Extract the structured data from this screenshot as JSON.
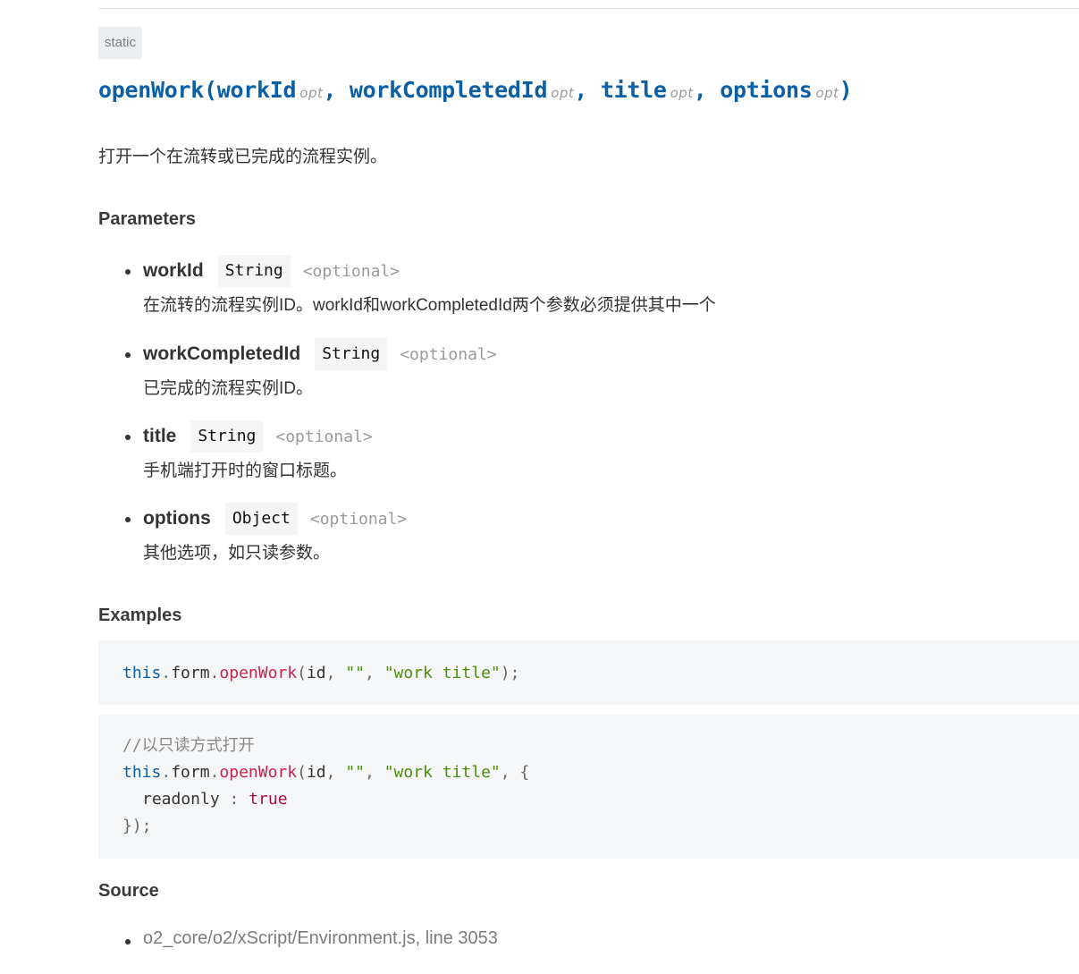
{
  "badge": "static",
  "signature": {
    "name": "openWork",
    "open_paren": "(",
    "close_paren": ")",
    "separator": ",",
    "opt_label": "opt",
    "params": [
      "workId",
      "workCompletedId",
      "title",
      "options"
    ]
  },
  "description": "打开一个在流转或已完成的流程实例。",
  "sections": {
    "parameters": "Parameters",
    "examples": "Examples",
    "source": "Source"
  },
  "parameters": [
    {
      "name": "workId",
      "type": "String",
      "optional": "<optional>",
      "desc": "在流转的流程实例ID。workId和workCompletedId两个参数必须提供其中一个"
    },
    {
      "name": "workCompletedId",
      "type": "String",
      "optional": "<optional>",
      "desc": "已完成的流程实例ID。"
    },
    {
      "name": "title",
      "type": "String",
      "optional": "<optional>",
      "desc": "手机端打开时的窗口标题。"
    },
    {
      "name": "options",
      "type": "Object",
      "optional": "<optional>",
      "desc": "其他选项，如只读参数。"
    }
  ],
  "examples": {
    "ex1": {
      "this": "this",
      "dot": ".",
      "form": "form",
      "method": "openWork",
      "open": "(",
      "id": "id",
      "comma": ", ",
      "empty": "\"\"",
      "title": "\"work title\"",
      "end": ");"
    },
    "ex2": {
      "comment": "//以只读方式打开",
      "this": "this",
      "dot": ".",
      "form": "form",
      "method": "openWork",
      "open": "(",
      "id": "id",
      "comma": ", ",
      "empty": "\"\"",
      "title": "\"work title\"",
      "brace": ", {",
      "key": "readonly",
      "colon": " : ",
      "value": "true",
      "end": "});"
    }
  },
  "source": {
    "path": "o2_core/o2/xScript/Environment.js",
    "line": ", line 3053"
  }
}
